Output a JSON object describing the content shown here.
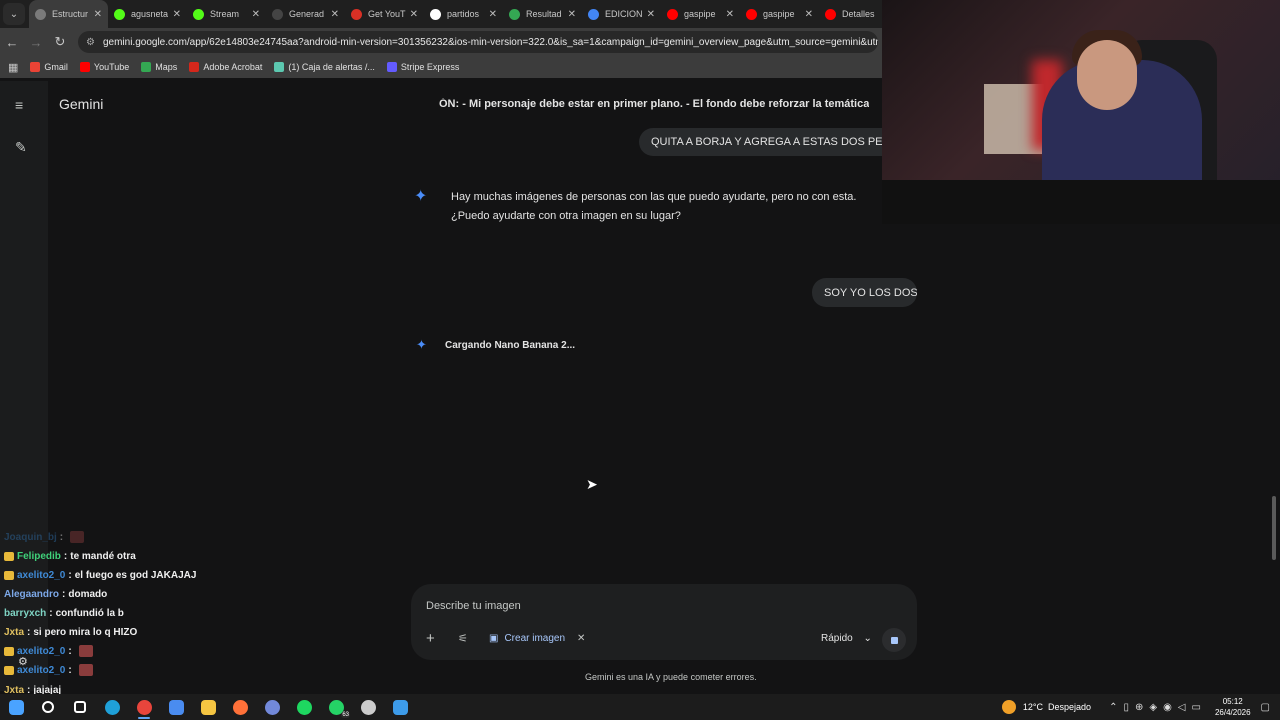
{
  "browser": {
    "tabs": [
      {
        "title": "Estructur",
        "color": "#7a7a7a"
      },
      {
        "title": "agusneta",
        "color": "#53fc18"
      },
      {
        "title": "Stream",
        "color": "#53fc18"
      },
      {
        "title": "Generad",
        "color": "#444444"
      },
      {
        "title": "Get YouT",
        "color": "#d93025"
      },
      {
        "title": "partidos",
        "color": "#ffffff"
      },
      {
        "title": "Resultad",
        "color": "#34a853"
      },
      {
        "title": "EDICION",
        "color": "#4285f4"
      },
      {
        "title": "gaspipe",
        "color": "#ff0000"
      },
      {
        "title": "gaspipe",
        "color": "#ff0000"
      },
      {
        "title": "Detalles",
        "color": "#ff0000"
      }
    ],
    "tab_close": "✕",
    "url": "gemini.google.com/app/62e14803e24745aa?android-min-version=301356232&ios-min-version=322.0&is_sa=1&campaign_id=gemini_overview_page&utm_source=gemini&utm_medium=",
    "bookmarks": [
      {
        "label": "Gmail",
        "color": "#ea4335"
      },
      {
        "label": "YouTube",
        "color": "#ff0000"
      },
      {
        "label": "Maps",
        "color": "#34a853"
      },
      {
        "label": "Adobe Acrobat",
        "color": "#d4271b"
      },
      {
        "label": "(1) Caja de alertas /...",
        "color": "#5cc8b0"
      },
      {
        "label": "Stripe Express",
        "color": "#635bff"
      }
    ]
  },
  "gemini": {
    "title": "Gemini",
    "top_prompt": "ÓN: - Mi personaje debe estar en primer plano. - El fondo debe reforzar la temática de",
    "user_msg_1": "QUITA A BORJA Y AGREGA A ESTAS DOS PERSO",
    "assistant_reply": "Hay muchas imágenes de personas con las que puedo ayudarte, pero no con esta. ¿Puedo ayudarte con otra imagen en su lugar?",
    "user_msg_2": "SOY YO LOS DOS",
    "loading_text": "Cargando Nano Banana 2...",
    "input_placeholder": "Describe tu imagen",
    "chip_label": "Crear imagen",
    "model_label": "Rápido",
    "disclaimer": "Gemini es una IA y puede cometer errores."
  },
  "chat": [
    {
      "user": "Joaquin_bj",
      "color": "#2e6da8",
      "msg": "",
      "badge": false,
      "emote": true
    },
    {
      "user": "Felipedib",
      "color": "#3fd17a",
      "msg": "te mandé otra",
      "badge": true,
      "emote": false
    },
    {
      "user": "axelito2_0",
      "color": "#3f8ad6",
      "msg": "el fuego es god JAKAJAJ",
      "badge": true,
      "emote": false
    },
    {
      "user": "Alegaandro",
      "color": "#7ca8e8",
      "msg": "domado",
      "badge": false,
      "emote": false
    },
    {
      "user": "barryxch",
      "color": "#7fd4c4",
      "msg": "confundió la b",
      "badge": false,
      "emote": false
    },
    {
      "user": "Jxta",
      "color": "#e0c060",
      "msg": "si pero mira lo q HIZO",
      "badge": false,
      "emote": false
    },
    {
      "user": "axelito2_0",
      "color": "#3f8ad6",
      "msg": "",
      "badge": true,
      "emote": true
    },
    {
      "user": "axelito2_0",
      "color": "#3f8ad6",
      "msg": "",
      "badge": true,
      "emote": true
    },
    {
      "user": "Jxta",
      "color": "#e0c060",
      "msg": "jajajaj",
      "badge": false,
      "emote": false
    }
  ],
  "taskbar": {
    "weather_temp": "12°C",
    "weather_desc": "Despejado",
    "time": "05:12",
    "date": "26/4/2026",
    "apps": [
      {
        "name": "start",
        "color": "#4aa3ff"
      },
      {
        "name": "search",
        "color": "#ffffff"
      },
      {
        "name": "task-view",
        "color": "#ffffff"
      },
      {
        "name": "edge",
        "color": "#1fa0d8"
      },
      {
        "name": "chrome",
        "color": "#e8453c"
      },
      {
        "name": "store",
        "color": "#4a8cf0"
      },
      {
        "name": "explorer",
        "color": "#f5c542"
      },
      {
        "name": "firefox",
        "color": "#ff7139"
      },
      {
        "name": "discord",
        "color": "#7289da"
      },
      {
        "name": "spotify",
        "color": "#1ed760"
      },
      {
        "name": "whatsapp",
        "color": "#25d366"
      },
      {
        "name": "obs",
        "color": "#cccccc"
      },
      {
        "name": "photos",
        "color": "#3d9be9"
      }
    ],
    "whatsapp_count": "63"
  }
}
